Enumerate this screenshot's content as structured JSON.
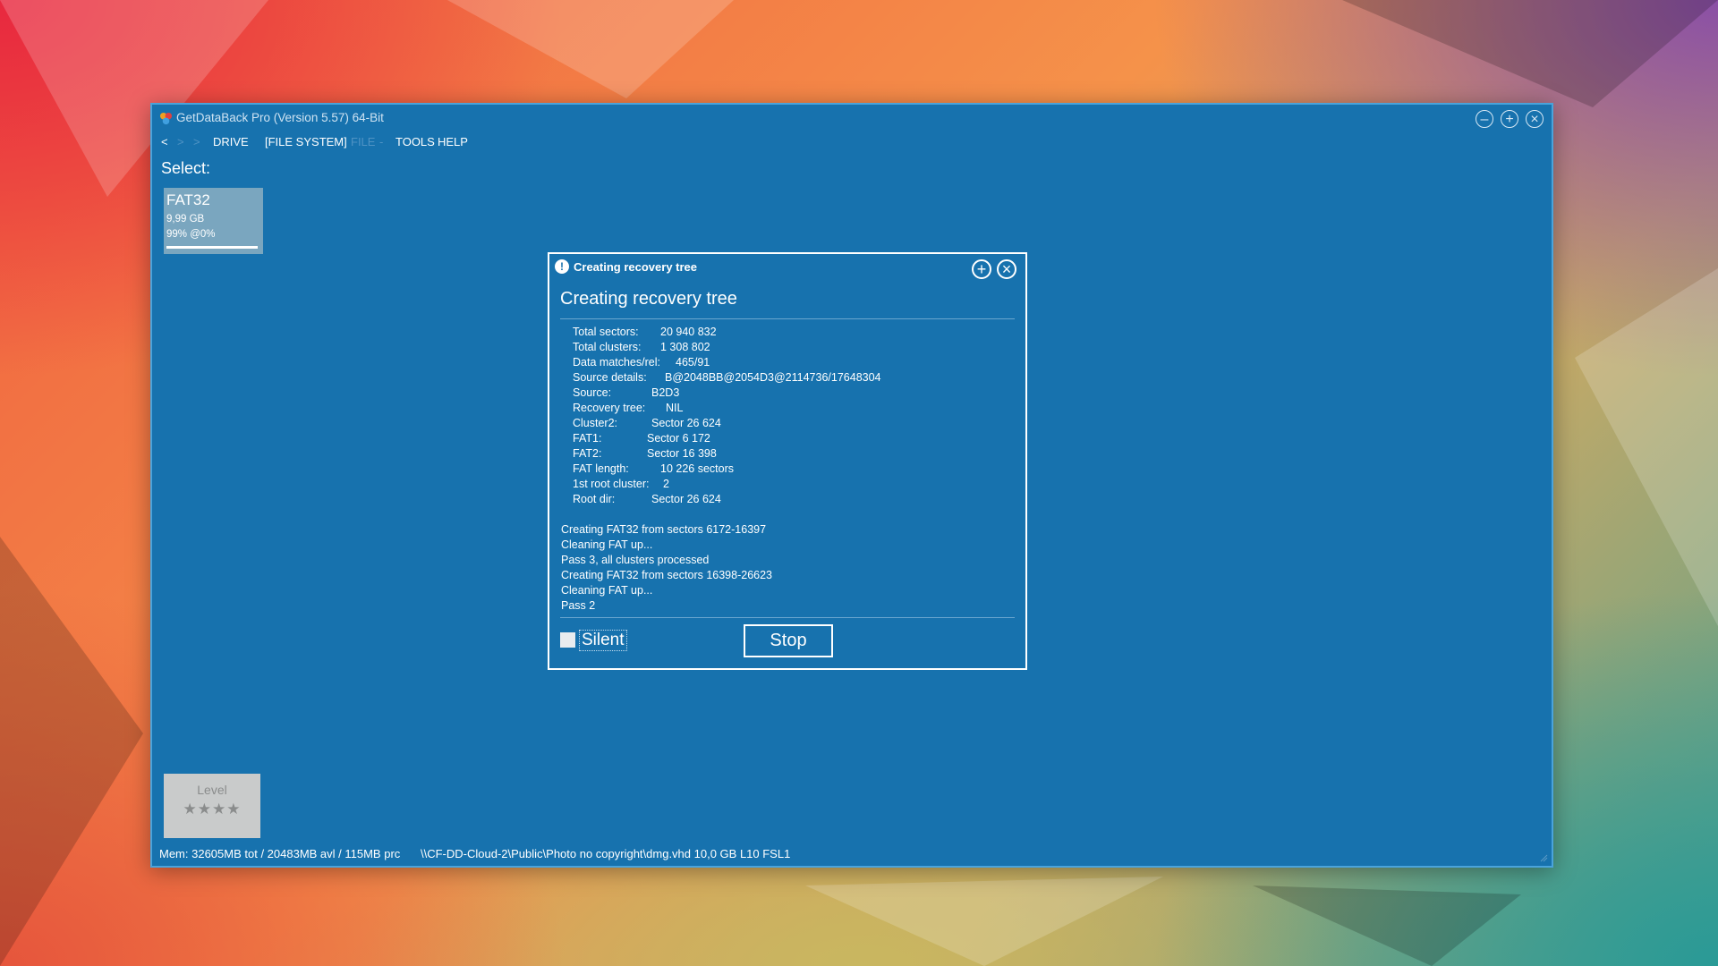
{
  "window": {
    "title": "GetDataBack Pro (Version 5.57) 64-Bit",
    "controls": {
      "minimize_icon": "minimize-icon",
      "maximize_icon": "maximize-icon",
      "close_icon": "close-icon"
    }
  },
  "menu": {
    "back": "<",
    "forward": ">",
    "sep": ">",
    "drive": "DRIVE",
    "file_system": "[FILE SYSTEM]",
    "file": "FILE",
    "file_sep": "-",
    "tools": "TOOLS",
    "help": "HELP"
  },
  "select_label": "Select:",
  "drive_tile": {
    "fs": "FAT32",
    "size": "9,99 GB",
    "percent": "99% @0%"
  },
  "level_tile": {
    "title": "Level",
    "stars": "★★★★"
  },
  "status": {
    "memory": "Mem: 32605MB tot / 20483MB avl / 115MB prc",
    "path": "\\\\CF-DD-Cloud-2\\Public\\Photo no copyright\\dmg.vhd 10,0 GB L10 FSL1"
  },
  "dialog": {
    "caption": "Creating recovery tree",
    "heading": "Creating recovery tree",
    "info": [
      {
        "key": "Total sectors:",
        "value": "20 940 832"
      },
      {
        "key": "Total clusters:",
        "value": "1 308 802"
      },
      {
        "key": "Data matches/rel:",
        "value": "465/91"
      },
      {
        "key": "Source details:",
        "value": "B@2048BB@2054D3@2114736/17648304"
      },
      {
        "key": "Source:",
        "value": "B2D3"
      },
      {
        "key": "Recovery tree:",
        "value": "NIL"
      },
      {
        "key": "Cluster2:",
        "value": "Sector 26 624"
      },
      {
        "key": "FAT1:",
        "value": "Sector 6 172"
      },
      {
        "key": "FAT2:",
        "value": "Sector 16 398"
      },
      {
        "key": "FAT length:",
        "value": "10 226 sectors"
      },
      {
        "key": "1st root cluster:",
        "value": "2"
      },
      {
        "key": "Root dir:",
        "value": "Sector 26 624"
      }
    ],
    "log": [
      "Creating FAT32 from sectors 6172-16397",
      "Cleaning FAT up...",
      "Pass 3, all clusters processed",
      "Creating FAT32 from sectors 16398-26623",
      "Cleaning FAT up...",
      "Pass 2"
    ],
    "silent_label": "Silent",
    "silent_checked": false,
    "stop_label": "Stop",
    "maximize_icon": "maximize-icon",
    "close_icon": "close-icon"
  },
  "colors": {
    "window_bg": "#1772ae",
    "border": "#4aa3db",
    "tile": "#7aa6bf",
    "level_tile": "#c9cbcb"
  }
}
